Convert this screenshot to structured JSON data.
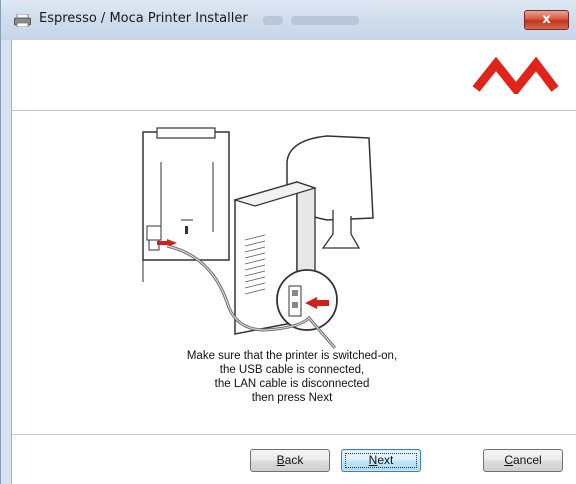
{
  "window": {
    "title": "Espresso / Moca Printer Installer",
    "icon": "printer-icon",
    "close_label": "x",
    "title_bar_color": "#cfdcec",
    "close_color": "#c3351e"
  },
  "header": {
    "logo": "m-logo",
    "logo_color": "#e2231a"
  },
  "instructions": {
    "line1": "Make sure that the printer is switched-on,",
    "line2": "the USB cable is connected,",
    "line3": "the LAN cable is disconnected",
    "line4": "then press Next"
  },
  "buttons": {
    "back": {
      "accel": "B",
      "rest": "ack"
    },
    "next": {
      "accel": "N",
      "rest": "ext"
    },
    "cancel": {
      "accel": "C",
      "rest": "ancel"
    }
  }
}
